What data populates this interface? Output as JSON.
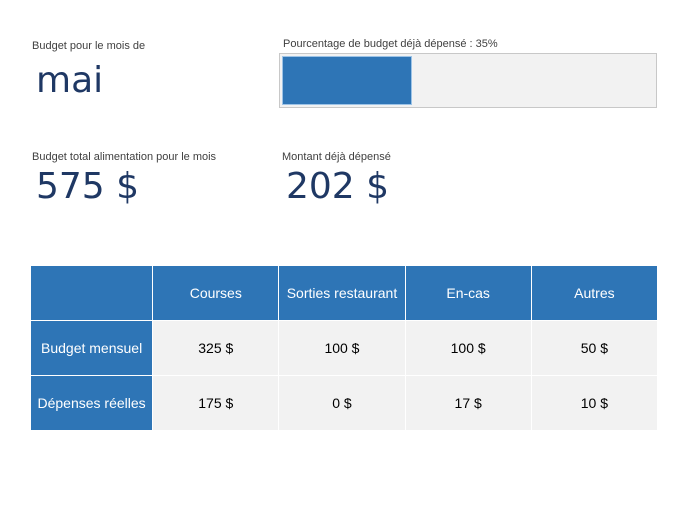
{
  "month": {
    "label": "Budget pour le mois de",
    "value": "mai"
  },
  "progress": {
    "label": "Pourcentage de budget déjà dépensé : 35%",
    "percent": 35,
    "color": "#2e75b6"
  },
  "total": {
    "label": "Budget total alimentation pour le mois",
    "value": "575 $"
  },
  "spent": {
    "label": "Montant déjà dépensé",
    "value": "202 $"
  },
  "table": {
    "columns": [
      "Courses",
      "Sorties restaurant",
      "En-cas",
      "Autres"
    ],
    "rows": [
      {
        "label": "Budget mensuel",
        "values": [
          "325 $",
          "100 $",
          "100 $",
          "50 $"
        ]
      },
      {
        "label": "Dépenses réelles",
        "values": [
          "175 $",
          "0 $",
          "17 $",
          "10 $"
        ]
      }
    ]
  },
  "colors": {
    "accent": "#2e75b6",
    "title_text": "#1f3864",
    "cell_bg": "#f2f2f2"
  }
}
